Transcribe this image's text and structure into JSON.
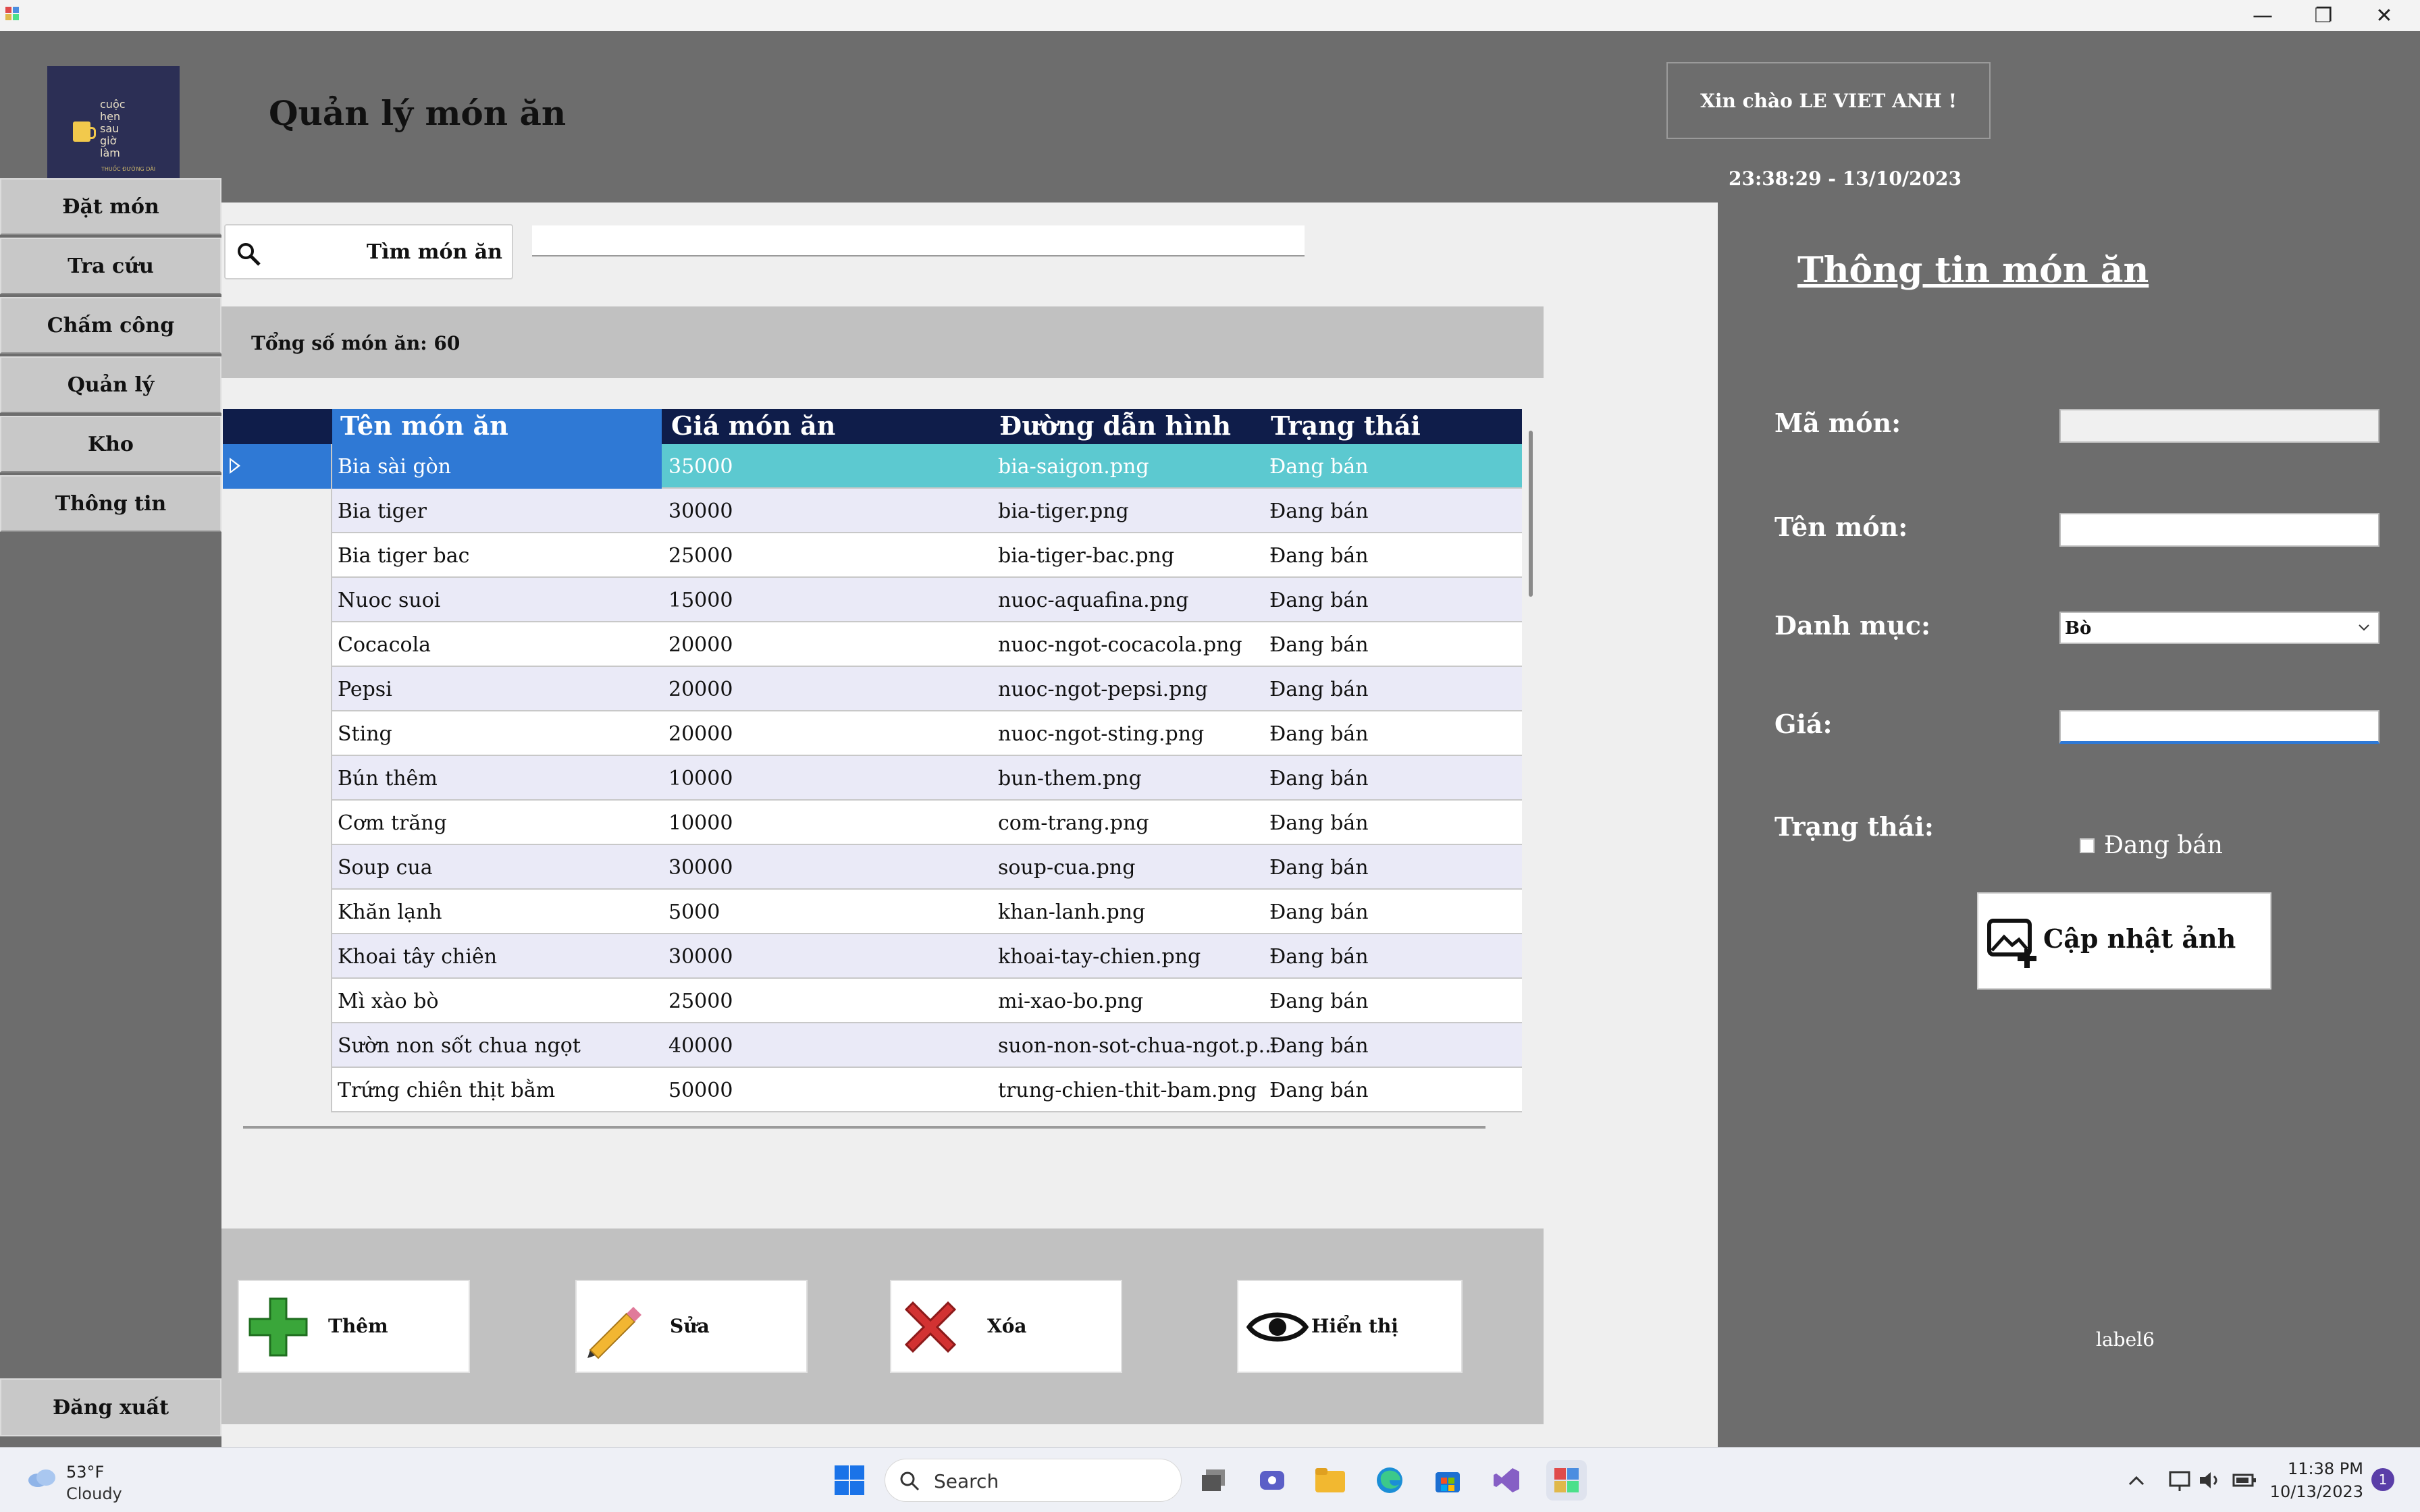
{
  "window": {
    "minimize_icon": "minimize-icon",
    "restore_icon": "restore-icon",
    "close_icon": "close-icon"
  },
  "logo": {
    "lines": [
      "cuộc",
      "hẹn",
      "sau",
      "giờ",
      "làm"
    ],
    "sub": "THUỐC ĐƯỜNG DÀI"
  },
  "page_title": "Quản lý món ăn",
  "greeting": "Xin chào LE VIET ANH !",
  "datetime": "23:38:29 - 13/10/2023",
  "sidebar": {
    "items": [
      {
        "label": "Đặt món"
      },
      {
        "label": "Tra cứu"
      },
      {
        "label": "Chấm công"
      },
      {
        "label": "Quản lý"
      },
      {
        "label": "Kho"
      },
      {
        "label": "Thông tin"
      }
    ],
    "logout": "Đăng xuất"
  },
  "search": {
    "label": "Tìm món ăn",
    "value": "",
    "placeholder": ""
  },
  "total": "Tổng số món ăn: 60",
  "table": {
    "columns": [
      "Tên món ăn",
      "Giá món ăn",
      "Đường dẫn hình",
      "Trạng thái"
    ],
    "rows": [
      [
        "Bia sài gòn",
        "35000",
        "bia-saigon.png",
        "Đang bán"
      ],
      [
        "Bia tiger",
        "30000",
        "bia-tiger.png",
        "Đang bán"
      ],
      [
        "Bia tiger bac",
        "25000",
        "bia-tiger-bac.png",
        "Đang bán"
      ],
      [
        "Nuoc suoi",
        "15000",
        "nuoc-aquafina.png",
        "Đang bán"
      ],
      [
        "Cocacola",
        "20000",
        "nuoc-ngot-cocacola.png",
        "Đang bán"
      ],
      [
        "Pepsi",
        "20000",
        "nuoc-ngot-pepsi.png",
        "Đang bán"
      ],
      [
        "Sting",
        "20000",
        "nuoc-ngot-sting.png",
        "Đang bán"
      ],
      [
        "Bún thêm",
        "10000",
        "bun-them.png",
        "Đang bán"
      ],
      [
        "Cơm trăng",
        "10000",
        "com-trang.png",
        "Đang bán"
      ],
      [
        "Soup cua",
        "30000",
        "soup-cua.png",
        "Đang bán"
      ],
      [
        "Khăn lạnh",
        "5000",
        "khan-lanh.png",
        "Đang bán"
      ],
      [
        "Khoai tây chiên",
        "30000",
        "khoai-tay-chien.png",
        "Đang bán"
      ],
      [
        "Mì xào bò",
        "25000",
        "mi-xao-bo.png",
        "Đang bán"
      ],
      [
        "Sườn non sốt chua ngọt",
        "40000",
        "suon-non-sot-chua-ngot.p...",
        "Đang bán"
      ],
      [
        "Trứng chiên thịt bằm",
        "50000",
        "trung-chien-thit-bam.png",
        "Đang bán"
      ]
    ]
  },
  "actions": {
    "add": "Thêm",
    "edit": "Sửa",
    "delete": "Xóa",
    "show": "Hiển thị"
  },
  "detail": {
    "title": "Thông tin món ăn",
    "id_label": "Mã món:",
    "id_value": "",
    "name_label": "Tên món:",
    "name_value": "",
    "category_label": "Danh mục:",
    "category_value": "Bò",
    "price_label": "Giá:",
    "price_value": "",
    "status_label": "Trạng thái:",
    "status_checkbox": "Đang bán",
    "upload_button": "Cập nhật ảnh",
    "label6": "label6"
  },
  "taskbar": {
    "temp": "53°F",
    "weather": "Cloudy",
    "search": "Search",
    "time": "11:38 PM",
    "date": "10/13/2023",
    "notifications": "1"
  },
  "colors": {
    "header": "#0f1d4a",
    "selected": "#2f79d5",
    "active_row": "#5cc9d0",
    "panel": "#6d6d6d"
  }
}
